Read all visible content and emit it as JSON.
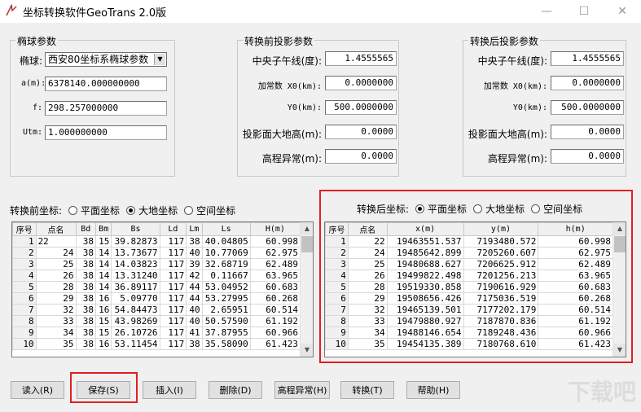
{
  "window": {
    "title": "坐标转换软件GeoTrans 2.0版",
    "minimize": "—",
    "maximize": "☐",
    "close": "✕"
  },
  "ellipsoid": {
    "group_title": "椭球参数",
    "ellipsoid_label": "椭球:",
    "ellipsoid_value": "西安80坐标系椭球参数",
    "a_label": "a(m):",
    "a_value": "6378140.000000000",
    "f_label": "f:",
    "f_value": "298.257000000",
    "utm_label": "Utm:",
    "utm_value": "1.000000000"
  },
  "before_proj": {
    "group_title": "转换前投影参数",
    "cm_label": "中央子午线(度):",
    "cm_value": "1.4555565",
    "x0_label": "加常数 X0(km):",
    "x0_value": "0.0000000",
    "y0_label": "Y0(km):",
    "y0_value": "500.0000000",
    "h_label": "投影面大地高(m):",
    "h_value": "0.0000",
    "geoid_label": "高程异常(m):",
    "geoid_value": "0.0000"
  },
  "after_proj": {
    "group_title": "转换后投影参数",
    "cm_label": "中央子午线(度):",
    "cm_value": "1.4555565",
    "x0_label": "加常数 X0(km):",
    "x0_value": "0.0000000",
    "y0_label": "Y0(km):",
    "y0_value": "500.0000000",
    "h_label": "投影面大地高(m):",
    "h_value": "0.0000",
    "geoid_label": "高程异常(m):",
    "geoid_value": "0.0000"
  },
  "before_coords": {
    "label": "转换前坐标:",
    "options": [
      "平面坐标",
      "大地坐标",
      "空间坐标"
    ],
    "selected": 1,
    "columns": [
      "序号",
      "点名",
      "Bd",
      "Bm",
      "Bs",
      "Ld",
      "Lm",
      "Ls",
      "H(m)"
    ],
    "rows": [
      [
        "1",
        "22",
        "38",
        "15",
        "39.82873",
        "117",
        "38",
        "40.04805",
        "60.998"
      ],
      [
        "2",
        "24",
        "38",
        "14",
        "13.73677",
        "117",
        "40",
        "10.77069",
        "62.975"
      ],
      [
        "3",
        "25",
        "38",
        "14",
        "14.03823",
        "117",
        "39",
        "32.68719",
        "62.489"
      ],
      [
        "4",
        "26",
        "38",
        "14",
        "13.31240",
        "117",
        "42",
        "0.11667",
        "63.965"
      ],
      [
        "5",
        "28",
        "38",
        "14",
        "36.89117",
        "117",
        "44",
        "53.04952",
        "60.683"
      ],
      [
        "6",
        "29",
        "38",
        "16",
        "5.09770",
        "117",
        "44",
        "53.27995",
        "60.268"
      ],
      [
        "7",
        "32",
        "38",
        "16",
        "54.84473",
        "117",
        "40",
        "2.65951",
        "60.514"
      ],
      [
        "8",
        "33",
        "38",
        "15",
        "43.98269",
        "117",
        "40",
        "50.57590",
        "61.192"
      ],
      [
        "9",
        "34",
        "38",
        "15",
        "26.10726",
        "117",
        "41",
        "37.87955",
        "60.966"
      ],
      [
        "10",
        "35",
        "38",
        "16",
        "53.11454",
        "117",
        "38",
        "35.58090",
        "61.423"
      ]
    ]
  },
  "after_coords": {
    "label": "转换后坐标:",
    "options": [
      "平面坐标",
      "大地坐标",
      "空间坐标"
    ],
    "selected": 0,
    "columns": [
      "序号",
      "点名",
      "x(m)",
      "y(m)",
      "h(m)"
    ],
    "rows": [
      [
        "1",
        "22",
        "19463551.537",
        "7193480.572",
        "60.998"
      ],
      [
        "2",
        "24",
        "19485642.899",
        "7205260.607",
        "62.975"
      ],
      [
        "3",
        "25",
        "19480688.627",
        "7206625.912",
        "62.489"
      ],
      [
        "4",
        "26",
        "19499822.498",
        "7201256.213",
        "63.965"
      ],
      [
        "5",
        "28",
        "19519330.858",
        "7190616.929",
        "60.683"
      ],
      [
        "6",
        "29",
        "19508656.426",
        "7175036.519",
        "60.268"
      ],
      [
        "7",
        "32",
        "19465139.501",
        "7177202.179",
        "60.514"
      ],
      [
        "8",
        "33",
        "19479880.927",
        "7187870.836",
        "61.192"
      ],
      [
        "9",
        "34",
        "19488146.654",
        "7189248.436",
        "60.966"
      ],
      [
        "10",
        "35",
        "19454135.389",
        "7180768.610",
        "61.423"
      ]
    ]
  },
  "buttons": {
    "read": "读入(R)",
    "save": "保存(S)",
    "insert": "插入(I)",
    "delete": "删除(D)",
    "geoid": "高程异常(H)",
    "convert": "转换(T)",
    "help": "帮助(H)"
  },
  "watermark": "下载吧",
  "colors": {
    "highlight": "#e02020"
  }
}
